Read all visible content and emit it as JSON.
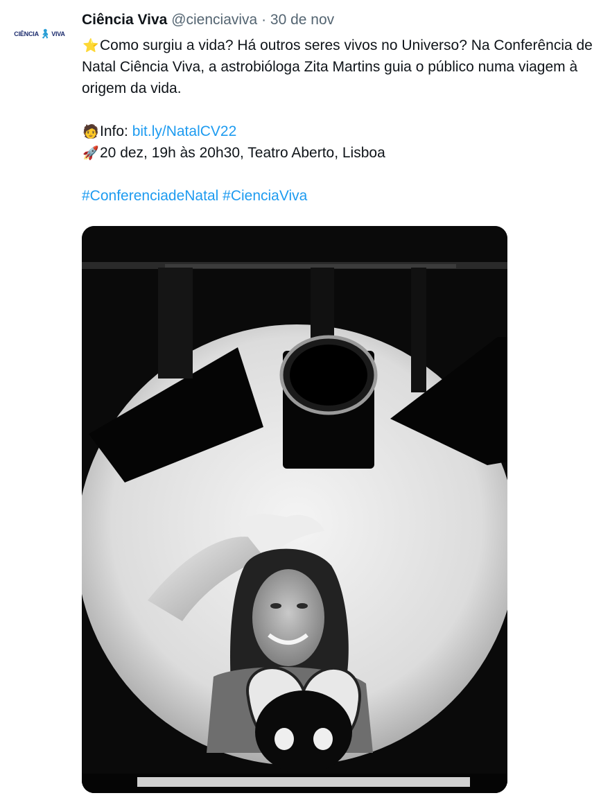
{
  "tweet": {
    "author_name": "Ciência Viva",
    "author_handle": "@cienciaviva",
    "separator": "·",
    "date": "30 de nov",
    "avatar": {
      "logo_text_left": "CIÊNCIA",
      "logo_text_right": "VIVA",
      "logo_figure_icon": "person-figure-icon",
      "logo_color": "#1a2a6c",
      "figure_color": "#2a9fd6"
    },
    "line1_emoji": "⭐",
    "line1_text": "Como surgiu a vida? Há outros seres vivos no Universo? Na Conferência de Natal Ciência Viva, a astrobióloga Zita Martins guia o público numa viagem à origem da vida.",
    "info_emoji": "🧑",
    "info_label": "Info: ",
    "info_link": "bit.ly/NatalCV22",
    "event_emoji": "🚀",
    "event_text": "20 dez, 19h às 20h30, Teatro Aberto, Lisboa",
    "hashtag_1": "#ConferenciadeNatal",
    "hashtag_2": "#CienciaViva",
    "link_color": "#1d9bf0",
    "media_description_icon": "photo-image",
    "media_alt": ""
  }
}
